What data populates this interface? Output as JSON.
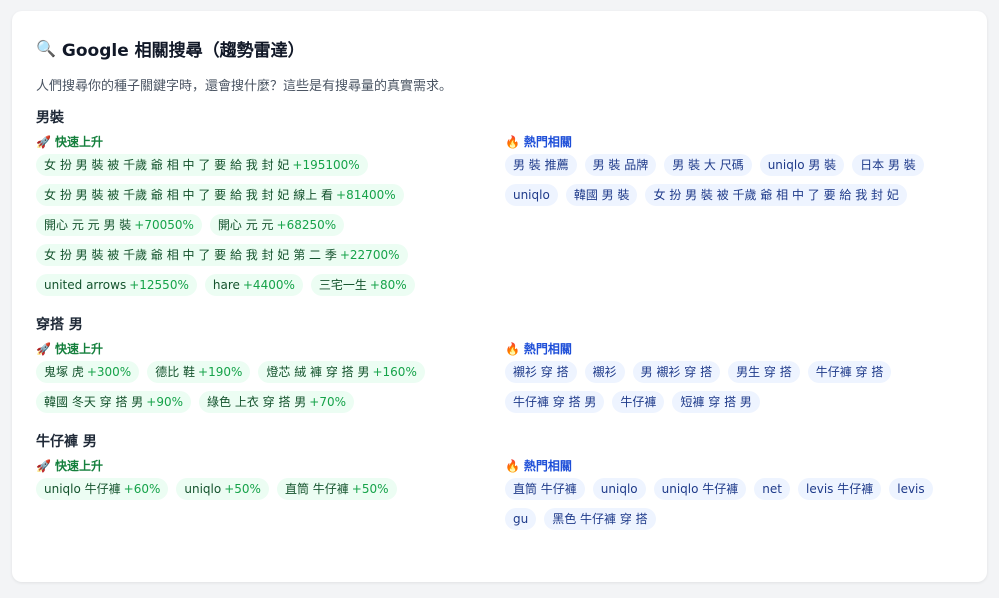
{
  "header": {
    "icon": "search-icon",
    "title": "Google 相關搜尋（趨勢雷達）",
    "description": "人們搜尋你的種子關鍵字時，還會搜什麼？這些是有搜尋量的真實需求。"
  },
  "labels": {
    "rising": "快速上升",
    "rising_icon": "rocket-icon",
    "hot": "熱門相關",
    "hot_icon": "fire-icon"
  },
  "colors": {
    "rising_text": "#15803d",
    "rising_bg": "#ecfdf3",
    "hot_text": "#1d4ed8",
    "hot_bg": "#eef4ff"
  },
  "sections": [
    {
      "title": "男裝",
      "rising": [
        {
          "term": "女 扮 男 裝 被 千歲 爺 相 中 了 要 給 我 封 妃",
          "pct": "+195100%"
        },
        {
          "term": "女 扮 男 裝 被 千歲 爺 相 中 了 要 給 我 封 妃 線上 看",
          "pct": "+81400%"
        },
        {
          "term": "開心 元 元 男 裝",
          "pct": "+70050%"
        },
        {
          "term": "開心 元 元",
          "pct": "+68250%"
        },
        {
          "term": "女 扮 男 裝 被 千歲 爺 相 中 了 要 給 我 封 妃 第 二 季",
          "pct": "+22700%"
        },
        {
          "term": "united arrows",
          "pct": "+12550%"
        },
        {
          "term": "hare",
          "pct": "+4400%"
        },
        {
          "term": "三宅一生",
          "pct": "+80%"
        }
      ],
      "hot": [
        "男 裝 推薦",
        "男 裝 品牌",
        "男 裝 大 尺碼",
        "uniqlo 男 裝",
        "日本 男 裝",
        "uniqlo",
        "韓國 男 裝",
        "女 扮 男 裝 被 千歲 爺 相 中 了 要 給 我 封 妃"
      ]
    },
    {
      "title": "穿搭 男",
      "rising": [
        {
          "term": "鬼塚 虎",
          "pct": "+300%"
        },
        {
          "term": "德比 鞋",
          "pct": "+190%"
        },
        {
          "term": "燈芯 絨 褲 穿 搭 男",
          "pct": "+160%"
        },
        {
          "term": "韓國 冬天 穿 搭 男",
          "pct": "+90%"
        },
        {
          "term": "綠色 上衣 穿 搭 男",
          "pct": "+70%"
        }
      ],
      "hot": [
        "襯衫 穿 搭",
        "襯衫",
        "男 襯衫 穿 搭",
        "男生 穿 搭",
        "牛仔褲 穿 搭",
        "牛仔褲 穿 搭 男",
        "牛仔褲",
        "短褲 穿 搭 男"
      ]
    },
    {
      "title": "牛仔褲 男",
      "rising": [
        {
          "term": "uniqlo 牛仔褲",
          "pct": "+60%"
        },
        {
          "term": "uniqlo",
          "pct": "+50%"
        },
        {
          "term": "直筒 牛仔褲",
          "pct": "+50%"
        }
      ],
      "hot": [
        "直筒 牛仔褲",
        "uniqlo",
        "uniqlo 牛仔褲",
        "net",
        "levis 牛仔褲",
        "levis",
        "gu",
        "黑色 牛仔褲 穿 搭"
      ]
    }
  ]
}
